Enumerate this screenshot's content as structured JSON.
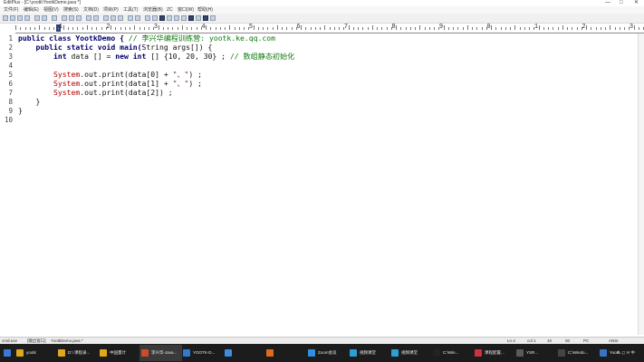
{
  "window": {
    "title": "EditPlus - [C:\\yootk\\YootkDemo.java *]",
    "minimize": "—",
    "maximize": "□",
    "close": "✕"
  },
  "menu": [
    "文件(F)",
    "编辑(E)",
    "视图(V)",
    "搜索(S)",
    "文档(D)",
    "项目(P)",
    "工具(T)",
    "浏览器(B)",
    "ZC",
    "窗口(W)",
    "帮助(H)"
  ],
  "ruler": {
    "labels": [
      "1",
      "2",
      "3",
      "4",
      "5",
      "6",
      "7",
      "8",
      "9",
      "0",
      "1",
      "2",
      "3"
    ]
  },
  "editor": {
    "line_numbers": [
      "1",
      "2",
      "3",
      "4",
      "5",
      "6",
      "7",
      "8",
      "9",
      "10"
    ],
    "lines": [
      {
        "segments": [
          {
            "t": "public class YootkDemo { ",
            "c": "kw"
          },
          {
            "t": "// 李兴华编程训练营: yootk.ke.qq.com",
            "c": "cmt"
          }
        ]
      },
      {
        "segments": [
          {
            "t": "    public static void main(",
            "c": "kw"
          },
          {
            "t": "String args[]) {",
            "c": ""
          }
        ]
      },
      {
        "segments": [
          {
            "t": "        int",
            "c": "kw"
          },
          {
            "t": " data [] = ",
            "c": ""
          },
          {
            "t": "new int",
            "c": "kw"
          },
          {
            "t": " [] {10, 20, 30} ; ",
            "c": ""
          },
          {
            "t": "// 数组静态初始化",
            "c": "cmt"
          }
        ]
      },
      {
        "segments": []
      },
      {
        "segments": [
          {
            "t": "        System",
            "c": "sys"
          },
          {
            "t": ".out.print(data[0] + ",
            "c": ""
          },
          {
            "t": "\"、\"",
            "c": "str"
          },
          {
            "t": ") ;",
            "c": ""
          }
        ]
      },
      {
        "segments": [
          {
            "t": "        System",
            "c": "sys"
          },
          {
            "t": ".out.print(data[1] + ",
            "c": ""
          },
          {
            "t": "\"、\"",
            "c": "str"
          },
          {
            "t": ") ;",
            "c": ""
          }
        ]
      },
      {
        "segments": [
          {
            "t": "        System",
            "c": "sys"
          },
          {
            "t": ".out.print(data[2]) ;",
            "c": ""
          }
        ]
      },
      {
        "segments": [
          {
            "t": "    }",
            "c": ""
          }
        ]
      },
      {
        "segments": [
          {
            "t": "}",
            "c": ""
          }
        ]
      },
      {
        "segments": []
      }
    ]
  },
  "statusbar": {
    "tabs": [
      "cmd.exe",
      "[输出窗口]",
      "YootkDemo.java *"
    ],
    "line_col": "Ln 4",
    "col": "col 1",
    "count": "10",
    "mode": "00",
    "encoding": "PC",
    "ansi": "ANSI"
  },
  "taskbar": {
    "items": [
      {
        "label": "yootk",
        "color": "#e0a81c"
      },
      {
        "label": "D:\\ 课程录...",
        "color": "#e0a81c"
      },
      {
        "label": "中国量计",
        "color": "#e0a81c"
      },
      {
        "label": "李兴华-Java...",
        "color": "#d04a2a"
      },
      {
        "label": "YOOTK-D...",
        "color": "#2f7ad1"
      },
      {
        "label": "",
        "color": "#3d8ee0"
      },
      {
        "label": "",
        "color": "#e06b1c"
      },
      {
        "label": "Zoom会议",
        "color": "#2f8fe0"
      },
      {
        "label": "视频课堂",
        "color": "#2aa0d6"
      },
      {
        "label": "视频课堂",
        "color": "#2aa0d6"
      },
      {
        "label": "C:\\Win...",
        "color": "#222222"
      },
      {
        "label": "课程配置...",
        "color": "#d0323a"
      },
      {
        "label": "YSR...",
        "color": "#5a5a5a"
      },
      {
        "label": "C:\\Windo...",
        "color": "#444444"
      },
      {
        "label": "Yootk...",
        "color": "#3a73c6"
      }
    ],
    "tray": "∧  ◻  ✉  中"
  }
}
